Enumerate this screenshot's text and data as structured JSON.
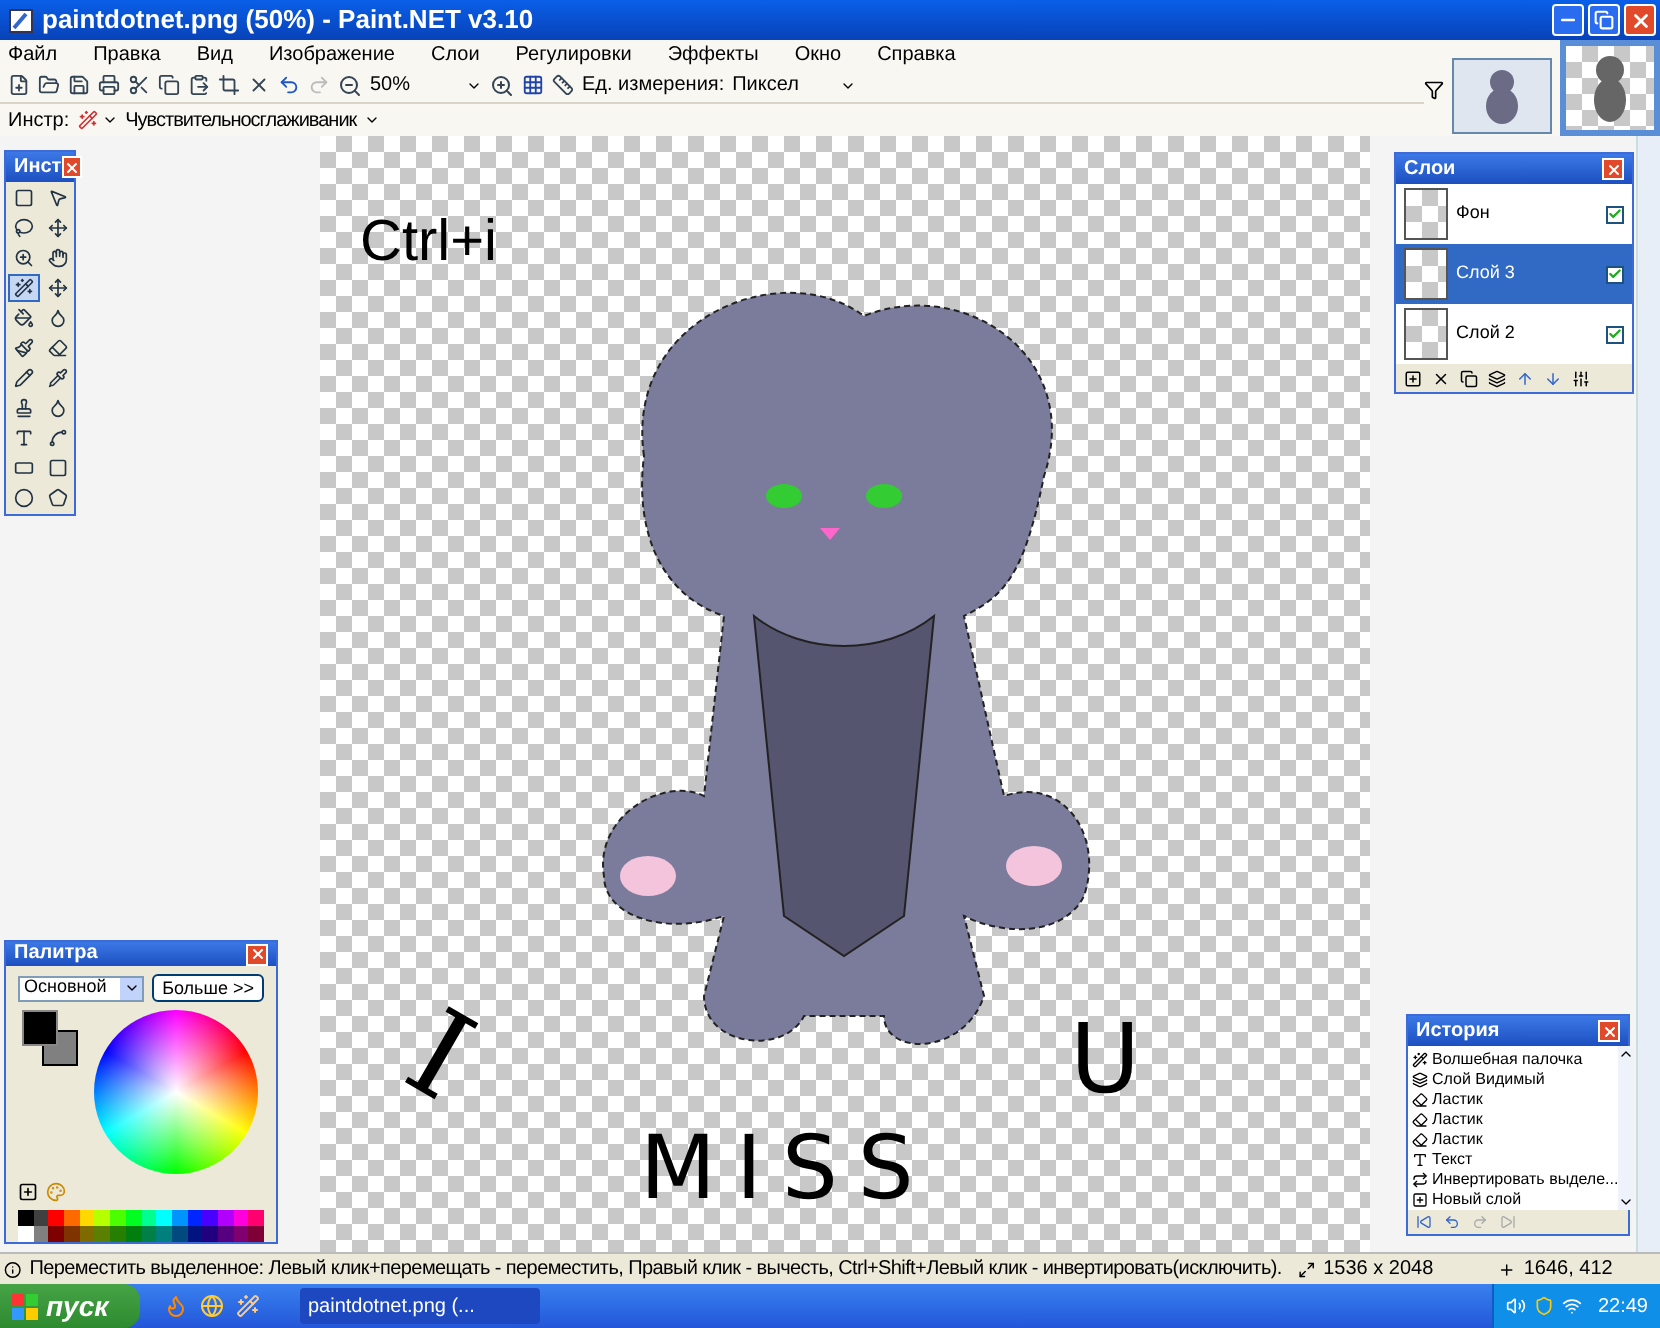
{
  "window": {
    "title": "paintdotnet.png (50%) - Paint.NET v3.10"
  },
  "menu": [
    "Файл",
    "Правка",
    "Вид",
    "Изображение",
    "Слои",
    "Регулировки",
    "Эффекты",
    "Окно",
    "Справка"
  ],
  "toolbar": {
    "zoom": "50%",
    "units_label": "Ед. измерения:",
    "units": "Пиксел",
    "redo_disabled": true
  },
  "tool_options": {
    "label": "Инстр:",
    "mode": "Чувствительносглаживаник"
  },
  "canvas": {
    "caption": "Ctrl+i",
    "handwriting": [
      "I",
      "MISS",
      "U"
    ]
  },
  "tools": {
    "title": "Инст",
    "items": [
      {
        "selected": false
      },
      {
        "selected": false
      },
      {
        "selected": false
      },
      {
        "selected": false
      },
      {
        "selected": false
      },
      {
        "selected": false
      },
      {
        "selected": true
      },
      {
        "selected": false
      },
      {
        "selected": false
      },
      {
        "selected": false
      },
      {
        "selected": false
      },
      {
        "selected": false
      },
      {
        "selected": false
      },
      {
        "selected": false
      },
      {
        "selected": false
      },
      {
        "selected": false
      },
      {
        "selected": false
      },
      {
        "selected": false
      },
      {
        "selected": false
      },
      {
        "selected": false
      },
      {
        "selected": false
      },
      {
        "selected": false
      }
    ]
  },
  "layers": {
    "title": "Слои",
    "items": [
      {
        "name": "Фон",
        "visible": true,
        "selected": false
      },
      {
        "name": "Слой 3",
        "visible": true,
        "selected": true
      },
      {
        "name": "Слой 2",
        "visible": true,
        "selected": false
      }
    ]
  },
  "history": {
    "title": "История",
    "items": [
      {
        "kind": "wand",
        "label": "Волшебная палочка"
      },
      {
        "kind": "layer",
        "label": "Слой Видимый"
      },
      {
        "kind": "eraser",
        "label": "Ластик"
      },
      {
        "kind": "eraser",
        "label": "Ластик"
      },
      {
        "kind": "eraser",
        "label": "Ластик"
      },
      {
        "kind": "text",
        "label": "Текст"
      },
      {
        "kind": "invert",
        "label": "Инвертировать выделе..."
      },
      {
        "kind": "new_layer",
        "label": "Новый слой"
      }
    ]
  },
  "palette": {
    "title": "Палитра",
    "mode": "Основной",
    "more": "Больше >>",
    "colors": [
      {
        "color": "#000000"
      },
      {
        "color": "#808080"
      }
    ],
    "swatches": [
      {
        "color": "#000000"
      },
      {
        "color": "#404040"
      },
      {
        "color": "#ff0000"
      },
      {
        "color": "#ff6a00"
      },
      {
        "color": "#ffd800"
      },
      {
        "color": "#b6ff00"
      },
      {
        "color": "#4cff00"
      },
      {
        "color": "#00ff21"
      },
      {
        "color": "#00ff90"
      },
      {
        "color": "#00ffff"
      },
      {
        "color": "#0094ff"
      },
      {
        "color": "#0026ff"
      },
      {
        "color": "#4800ff"
      },
      {
        "color": "#b200ff"
      },
      {
        "color": "#ff00dc"
      },
      {
        "color": "#ff006e"
      },
      {
        "color": "#ffffff"
      },
      {
        "color": "#808080"
      },
      {
        "color": "#7f0000"
      },
      {
        "color": "#7f3300"
      },
      {
        "color": "#7f6a00"
      },
      {
        "color": "#5b7f00"
      },
      {
        "color": "#267f00"
      },
      {
        "color": "#007f0e"
      },
      {
        "color": "#007f46"
      },
      {
        "color": "#007f7f"
      },
      {
        "color": "#004a7f"
      },
      {
        "color": "#00137f"
      },
      {
        "color": "#21007f"
      },
      {
        "color": "#57007f"
      },
      {
        "color": "#7f006e"
      },
      {
        "color": "#7f0037"
      }
    ]
  },
  "status_bar": {
    "hint": "Переместить выделенное: Левый клик+перемещать - переместить, Правый клик - вычесть, Ctrl+Shift+Левый клик - инвертировать(исключить).",
    "size": "1536 x 2048",
    "position": "1646, 412"
  },
  "taskbar": {
    "start": "пуск",
    "task": "paintdotnet.png (...",
    "time": "22:49"
  }
}
